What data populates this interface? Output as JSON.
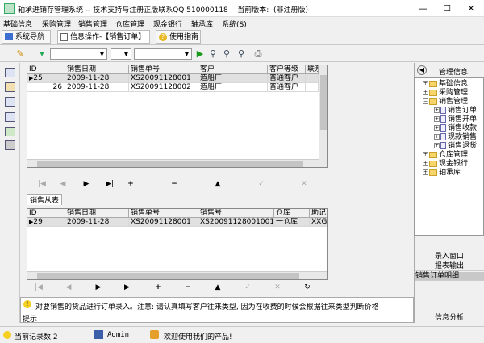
{
  "window": {
    "title": "轴承进销存管理系统 -- 技术支持与注册正版联系QQ 510000118",
    "version_label": "当前版本:",
    "version_value": "(非注册版)",
    "minimize": "—",
    "maximize": "☐",
    "close": "✕"
  },
  "menu": [
    "基础信息",
    "采购管理",
    "销售管理",
    "仓库管理",
    "现金银行",
    "轴承库",
    "系统(S)"
  ],
  "nav": {
    "tab1": "系统导航",
    "tab2": "信息操作-【销售订单】",
    "help": "使用指南"
  },
  "toolbar": {
    "combo1": "",
    "combo2": "",
    "combo3": ""
  },
  "master": {
    "columns": [
      "ID",
      "销售日期",
      "销售单号",
      "客户",
      "客户等级",
      "联系"
    ],
    "rows": [
      [
        "25",
        "2009-11-28",
        "XS20091128001",
        "造船厂",
        "普通客户",
        ""
      ],
      [
        "26",
        "2009-11-28",
        "XS20091128002",
        "造船厂",
        "普通客户",
        ""
      ]
    ]
  },
  "nav_symbols": {
    "first": "|◀",
    "prev": "◀",
    "next": "▶",
    "last": "▶|",
    "add": "+",
    "delete": "−",
    "up": "▲",
    "check": "✓",
    "cancel": "✕",
    "refresh": "↻"
  },
  "detail": {
    "title": "销售从表",
    "columns": [
      "ID",
      "销售日期",
      "销售单号",
      "销售号",
      "仓库",
      "助记"
    ],
    "rows": [
      [
        "29",
        "2009-11-28",
        "XS20091128001",
        "XS20091128001001",
        "一仓库",
        "XXG"
      ]
    ]
  },
  "hint": {
    "label": "提示",
    "text": "对要销售的货品进行订单录入。注意: 请认真填写客户往来类型, 因为在收费的时候会根据往来类型判断价格"
  },
  "tree": {
    "header": "管理信息",
    "nodes": [
      {
        "label": "基础信息",
        "level": 0,
        "kind": "folder",
        "sign": "+"
      },
      {
        "label": "采购管理",
        "level": 0,
        "kind": "folder",
        "sign": "+"
      },
      {
        "label": "销售管理",
        "level": 0,
        "kind": "folder",
        "sign": "−"
      },
      {
        "label": "销售订单",
        "level": 1,
        "kind": "doc",
        "sign": "+"
      },
      {
        "label": "销售开单",
        "level": 1,
        "kind": "doc",
        "sign": "+"
      },
      {
        "label": "销售收款",
        "level": 1,
        "kind": "doc",
        "sign": "+"
      },
      {
        "label": "现款销售",
        "level": 1,
        "kind": "doc",
        "sign": "+"
      },
      {
        "label": "销售退货",
        "level": 1,
        "kind": "doc",
        "sign": "+"
      },
      {
        "label": "仓库管理",
        "level": 0,
        "kind": "folder",
        "sign": "+"
      },
      {
        "label": "现金银行",
        "level": 0,
        "kind": "folder",
        "sign": "+"
      },
      {
        "label": "轴承库",
        "level": 0,
        "kind": "folder",
        "sign": "+"
      }
    ],
    "buttons": [
      "录入窗口",
      "报表输出",
      "销售订单明细"
    ],
    "info": "信息分析"
  },
  "status": {
    "records": "当前记录数 2",
    "user": "Admin",
    "welcome": "欢迎使用我们的产品!"
  }
}
